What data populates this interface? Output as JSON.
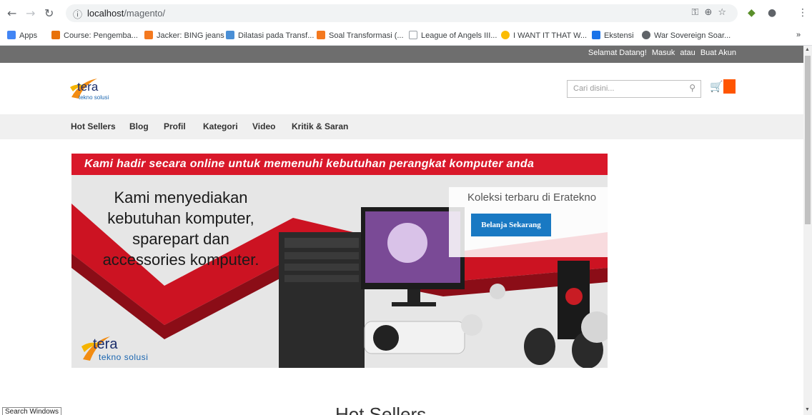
{
  "browser": {
    "url_host": "localhost",
    "url_path": "/magento/",
    "bookmarks": [
      {
        "label": "Apps",
        "color": "#4285f4"
      },
      {
        "label": "Course: Pengemba...",
        "color": "#e8710a"
      },
      {
        "label": "Jacker: BING jeans",
        "color": "#f4791f"
      },
      {
        "label": "Dilatasi pada Transf...",
        "color": "#4a8fd6"
      },
      {
        "label": "Soal Transformasi (...",
        "color": "#f4791f"
      },
      {
        "label": "League of Angels III...",
        "color": "#9aa0a6"
      },
      {
        "label": "I WANT IT THAT W...",
        "color": "#fbbc04"
      },
      {
        "label": "Ekstensi",
        "color": "#1a73e8"
      },
      {
        "label": "War Sovereign Soar...",
        "color": "#5f6368"
      }
    ],
    "overflow": "»"
  },
  "header": {
    "welcome": "Selamat Datang!",
    "sign_in": "Masuk",
    "or": "atau",
    "create_account": "Buat Akun",
    "logo_main": "tera",
    "logo_sub": "tekno solusi",
    "search_placeholder": "Cari disini..."
  },
  "menu": [
    "Hot Sellers",
    "Blog",
    "Profil",
    "Kategori",
    "Video",
    "Kritik & Saran"
  ],
  "banner": {
    "strip_text": "Kami hadir secara online untuk memenuhi kebutuhan perangkat komputer anda",
    "lines": [
      "Kami menyediakan",
      "kebutuhan komputer,",
      "sparepart dan",
      "accessories komputer."
    ],
    "promo_title": "Koleksi terbaru di Eratekno",
    "promo_button": "Belanja Sekarang",
    "logo_main": "tera",
    "logo_sub": "tekno solusi"
  },
  "section_title": "Hot Sellers",
  "status_tip": "Search Windows",
  "colors": {
    "accent": "#1979c3",
    "cart_badge": "#ff5501",
    "strip": "#d9182a",
    "topbar": "#6e6e6e"
  }
}
